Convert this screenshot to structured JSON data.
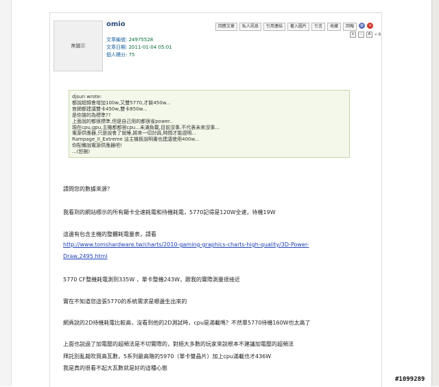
{
  "post": {
    "avatar_text": "無圖示",
    "username": "omio",
    "meta": [
      {
        "label": "文章編號:",
        "value": "24975528"
      },
      {
        "label": "文章日期:",
        "value": "2011-01-04 05:01"
      },
      {
        "label": "個人積分:",
        "value": "75"
      }
    ],
    "actions": [
      "回應文章",
      "私人訊息",
      "引用連結",
      "著入圖片",
      "引言",
      "收藏",
      "回報"
    ],
    "jump_label": "» 6"
  },
  "quote": {
    "lines": [
      "djsun wrote:",
      "都說超頻會增加100w,又雙5770,才裝450w...",
      "官網都建議雙卡450w,雙卡850w...",
      "是你誰的為標準??",
      "上面說的都很標準,但是自己用的都很省power..",
      "現在cpu,gpu,主機都都很cpu...未滿負載,目前沒事,不代表未來沒事...",
      "電源供應器,只是說會了就睡,將來一切討員,時間才能證明...",
      "Rampage_II_Extreme 這主機板說明書也建議使用400w...",
      "你配備說電源供應器吧!",
      "...(恕刪)"
    ]
  },
  "body": {
    "p1": "請問您的數據來源？",
    "p2": "我看到的網站標示的所有顯卡全速耗電和待機耗電，5770記得是120W全速，待機19W",
    "p3": "這邊有包含主機的整體耗電量表，請看",
    "link_line1": "http://www.tomshardware.tw/charts/2010-gaming-graphics-charts-high-quality/3D-Power-",
    "link_line2": "Draw,2495.html",
    "p4": "5770 CF整機耗電測到335W ，單卡整機243W，跟我的實際測量很接近",
    "p5": "實在不知道您這張5770的系統需求是哪邊生出來的",
    "p6": "網頁說的2D待機耗電比較高，沒看到他的2D測試時，cpu是滿載嗎？不然單5770待機160W也太高了",
    "p7a": "上面也說過了加電壓的超頻法是不切實際的，對絕大多數的玩家來說根本不建議加電壓的超頻法",
    "p7b": "拜託別亂裁吹買高瓦數，5系列最高階的5970（單卡雙晶片）加上cpu滿載也才436W",
    "p7c": "我是真的很看不起大瓦數就是好的這種心態"
  },
  "watermark": "#1099289"
}
